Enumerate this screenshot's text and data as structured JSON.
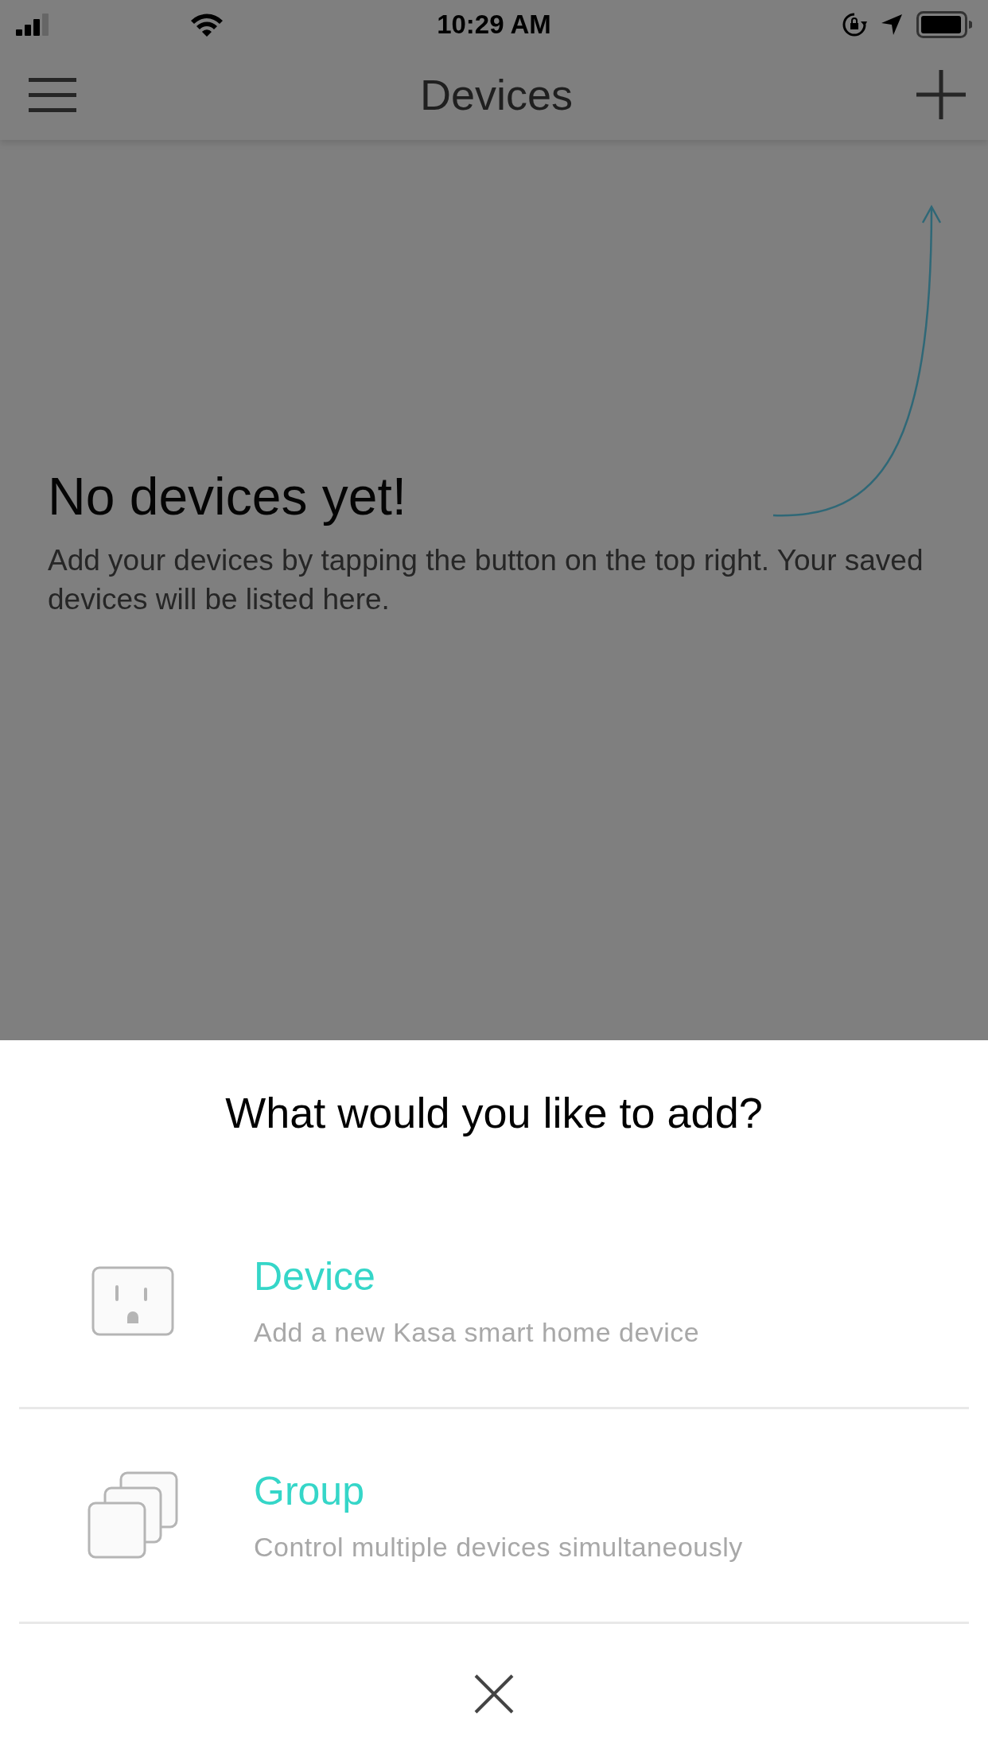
{
  "status_bar": {
    "time": "10:29 AM"
  },
  "nav_bar": {
    "title": "Devices"
  },
  "empty_state": {
    "title": "No devices yet!",
    "message": "Add your devices by tapping the button on the top right.  Your saved devices will be listed here."
  },
  "sheet": {
    "title": "What would you like to add?",
    "options": [
      {
        "kind": "device",
        "title": "Device",
        "subtitle": "Add a new Kasa smart home device"
      },
      {
        "kind": "group",
        "title": "Group",
        "subtitle": "Control multiple devices simultaneously"
      }
    ]
  }
}
